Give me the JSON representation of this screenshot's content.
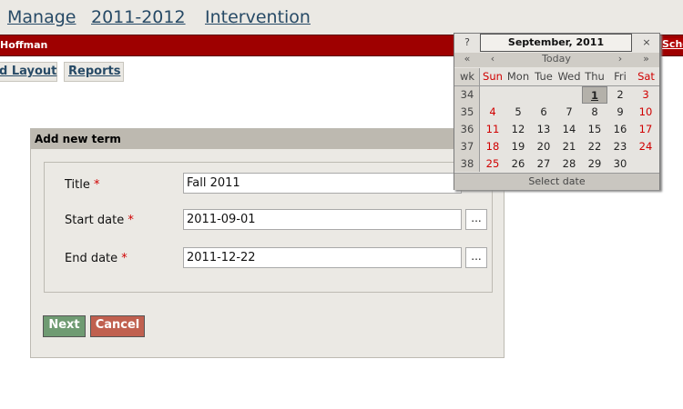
{
  "nav": {
    "items": [
      "Manage",
      "2011-2012",
      "Intervention"
    ]
  },
  "userbar": {
    "user": "Hoffman",
    "school": "Scho"
  },
  "subnav": {
    "items": [
      "d Layout",
      "Reports"
    ]
  },
  "form": {
    "header": "Add new term",
    "fields": [
      {
        "label": "Title",
        "required": "*",
        "value": "Fall 2011"
      },
      {
        "label": "Start date",
        "required": "*",
        "value": "2011-09-01",
        "picker": "..."
      },
      {
        "label": "End date",
        "required": "*",
        "value": "2011-12-22",
        "picker": "..."
      }
    ],
    "next_label": "Next",
    "cancel_label": "Cancel"
  },
  "calendar": {
    "help": "?",
    "title": "September, 2011",
    "close": "×",
    "nav": {
      "prev_year": "«",
      "prev_month": "‹",
      "today": "Today",
      "next_month": "›",
      "next_year": "»"
    },
    "day_headers": [
      "wk",
      "Sun",
      "Mon",
      "Tue",
      "Wed",
      "Thu",
      "Fri",
      "Sat"
    ],
    "weeks": [
      {
        "wk": "34",
        "days": [
          "",
          "",
          "",
          "",
          "1",
          "2",
          "3"
        ]
      },
      {
        "wk": "35",
        "days": [
          "4",
          "5",
          "6",
          "7",
          "8",
          "9",
          "10"
        ]
      },
      {
        "wk": "36",
        "days": [
          "11",
          "12",
          "13",
          "14",
          "15",
          "16",
          "17"
        ]
      },
      {
        "wk": "37",
        "days": [
          "18",
          "19",
          "20",
          "21",
          "22",
          "23",
          "24"
        ]
      },
      {
        "wk": "38",
        "days": [
          "25",
          "26",
          "27",
          "28",
          "29",
          "30",
          ""
        ]
      }
    ],
    "selected_day": "1",
    "footer": "Select date"
  }
}
